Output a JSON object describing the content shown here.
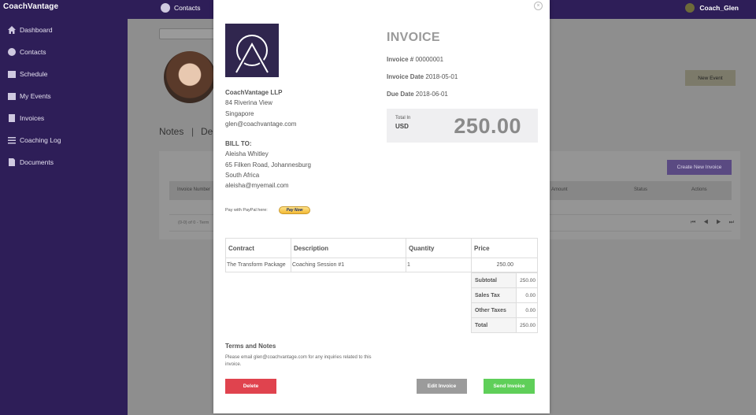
{
  "app": {
    "brand": "CoachVantage",
    "user": "Coach_Glen",
    "top_section": "Contacts"
  },
  "sidebar": {
    "items": [
      {
        "label": "Dashboard",
        "icon": "home-icon"
      },
      {
        "label": "Contacts",
        "icon": "smiley-icon"
      },
      {
        "label": "Schedule",
        "icon": "calendar-icon"
      },
      {
        "label": "My Events",
        "icon": "events-icon"
      },
      {
        "label": "Invoices",
        "icon": "dollar-icon"
      },
      {
        "label": "Coaching Log",
        "icon": "list-icon"
      },
      {
        "label": "Documents",
        "icon": "document-icon"
      }
    ]
  },
  "background": {
    "new_event": "New Event",
    "tab_notes": "Notes",
    "tab_sep": "|",
    "tab_partial": "De",
    "create_invoice": "Create New Invoice",
    "table_headers": {
      "invoice_number": "Invoice Number",
      "amount": "Amount",
      "status": "Status",
      "actions": "Actions"
    },
    "row_count": "(0-0) of 0 - Term",
    "pager": "⏮ ◀ ▶ ⏭"
  },
  "invoice": {
    "title": "INVOICE",
    "number_label": "Invoice #",
    "number": "00000001",
    "date_label": "Invoice Date",
    "date": "2018-05-01",
    "due_label": "Due Date",
    "due": "2018-06-01",
    "total_in_label": "Total In",
    "currency": "USD",
    "total": "250.00",
    "from": {
      "company": "CoachVantage LLP",
      "address1": "84 Riverina View",
      "address2": "Singapore",
      "email": "glen@coachvantage.com"
    },
    "bill_to": {
      "label": "BILL TO:",
      "name": "Aleisha Whitley",
      "address1": "65 Filken Road, Johannesburg",
      "address2": "South Africa",
      "email": "aleisha@myemail.com"
    },
    "paypal_label": "Pay with PayPal here:",
    "paypal_button": "Pay Now",
    "columns": {
      "contract": "Contract",
      "description": "Description",
      "quantity": "Quantity",
      "price": "Price"
    },
    "rows": [
      {
        "contract": "The Transform Package",
        "description": "Coaching Session #1",
        "quantity": "1",
        "price": "250.00"
      }
    ],
    "totals": {
      "subtotal_label": "Subtotal",
      "subtotal": "250.00",
      "sales_tax_label": "Sales Tax",
      "sales_tax": "0.00",
      "other_taxes_label": "Other Taxes",
      "other_taxes": "0.00",
      "total_label": "Total",
      "total": "250.00"
    },
    "terms_title": "Terms and Notes",
    "terms_text": "Please email glen@coachvantage.com for any inquiries related to this invoice.",
    "buttons": {
      "delete": "Delete",
      "edit": "Edit Invoice",
      "send": "Send Invoice"
    },
    "close": "×"
  },
  "colors": {
    "sidebar_bg": "#2e1e58",
    "logo_bg": "#30264e",
    "delete": "#e0434e",
    "edit": "#9b9b9b",
    "send": "#5fcf59"
  }
}
